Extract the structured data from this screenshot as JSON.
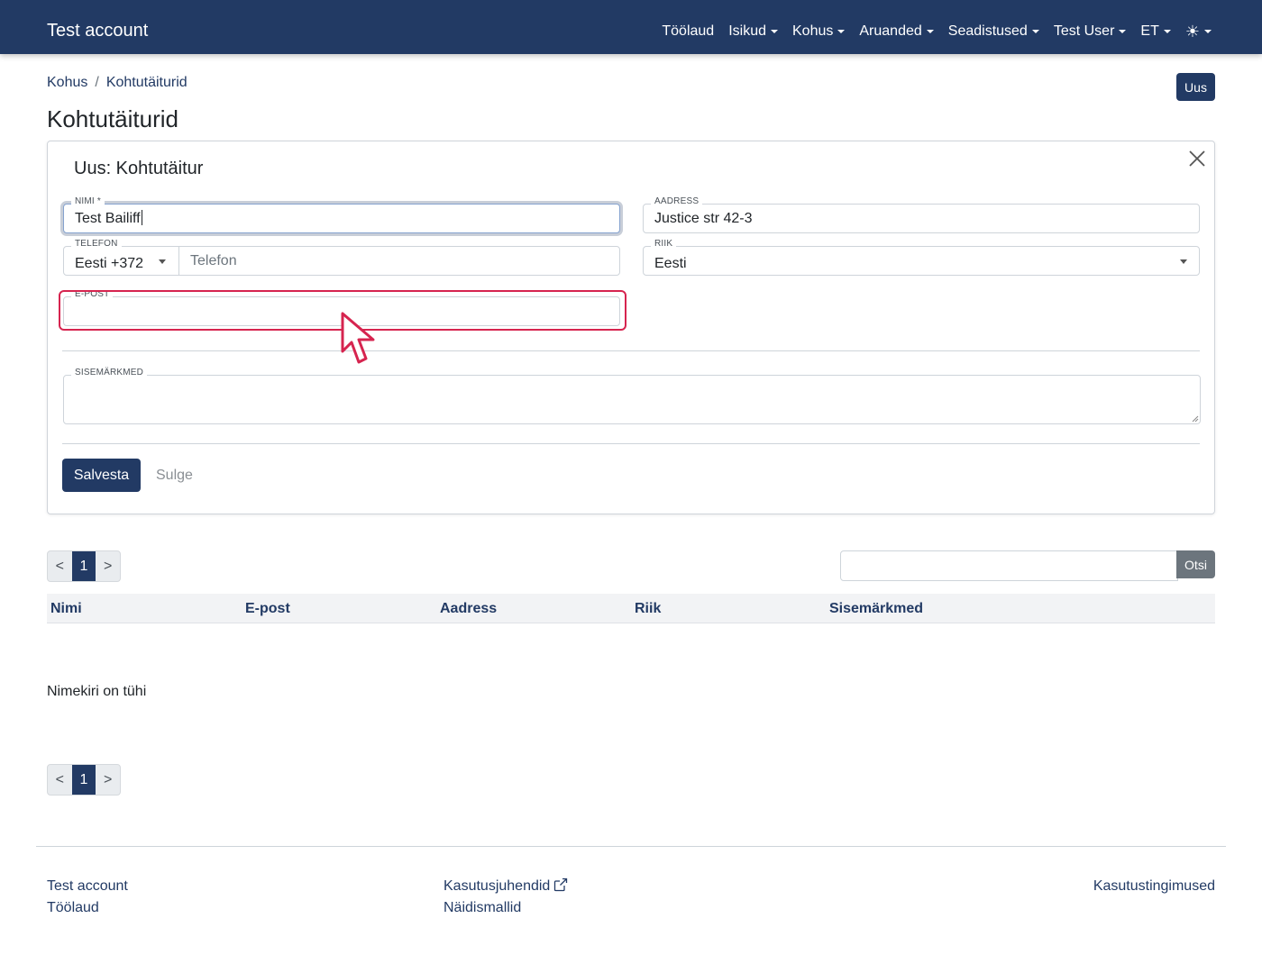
{
  "navbar": {
    "brand": "Test account",
    "items": [
      {
        "label": "Töölaud",
        "dropdown": false
      },
      {
        "label": "Isikud",
        "dropdown": true
      },
      {
        "label": "Kohus",
        "dropdown": true
      },
      {
        "label": "Aruanded",
        "dropdown": true
      },
      {
        "label": "Seadistused",
        "dropdown": true
      },
      {
        "label": "Test User",
        "dropdown": true
      },
      {
        "label": "ET",
        "dropdown": true
      }
    ],
    "theme_icon": "☀",
    "color": "#223a64"
  },
  "breadcrumb": {
    "items": [
      "Kohus",
      "Kohtutäiturid"
    ],
    "separator": "/"
  },
  "new_button": "Uus",
  "page_title": "Kohtutäiturid",
  "form": {
    "title": "Uus: Kohtutäitur",
    "fields": {
      "name": {
        "label": "NIMI *",
        "value": "Test Bailiff"
      },
      "address": {
        "label": "AADRESS",
        "value": "Justice str 42-3"
      },
      "phone": {
        "label": "TELEFON",
        "country_code": "Eesti +372",
        "placeholder": "Telefon"
      },
      "country": {
        "label": "RIIK",
        "value": "Eesti"
      },
      "email": {
        "label": "E-POST",
        "value": ""
      },
      "notes": {
        "label": "SISEMÄRKMED",
        "value": ""
      }
    },
    "save_label": "Salvesta",
    "close_label": "Sulge"
  },
  "pagination": {
    "prev": "<",
    "current": "1",
    "next": ">"
  },
  "search": {
    "button": "Otsi",
    "value": ""
  },
  "table": {
    "columns": [
      "Nimi",
      "E-post",
      "Aadress",
      "Riik",
      "Sisemärkmed"
    ],
    "empty_message": "Nimekiri on tühi"
  },
  "footer": {
    "col1": [
      "Test account",
      "Töölaud"
    ],
    "col2": [
      "Kasutusjuhendid",
      "Näidismallid"
    ],
    "col3": [
      "Kasutustingimused"
    ]
  },
  "colors": {
    "primary": "#223a64",
    "highlight": "#d6244f",
    "secondary": "#6c757d"
  }
}
